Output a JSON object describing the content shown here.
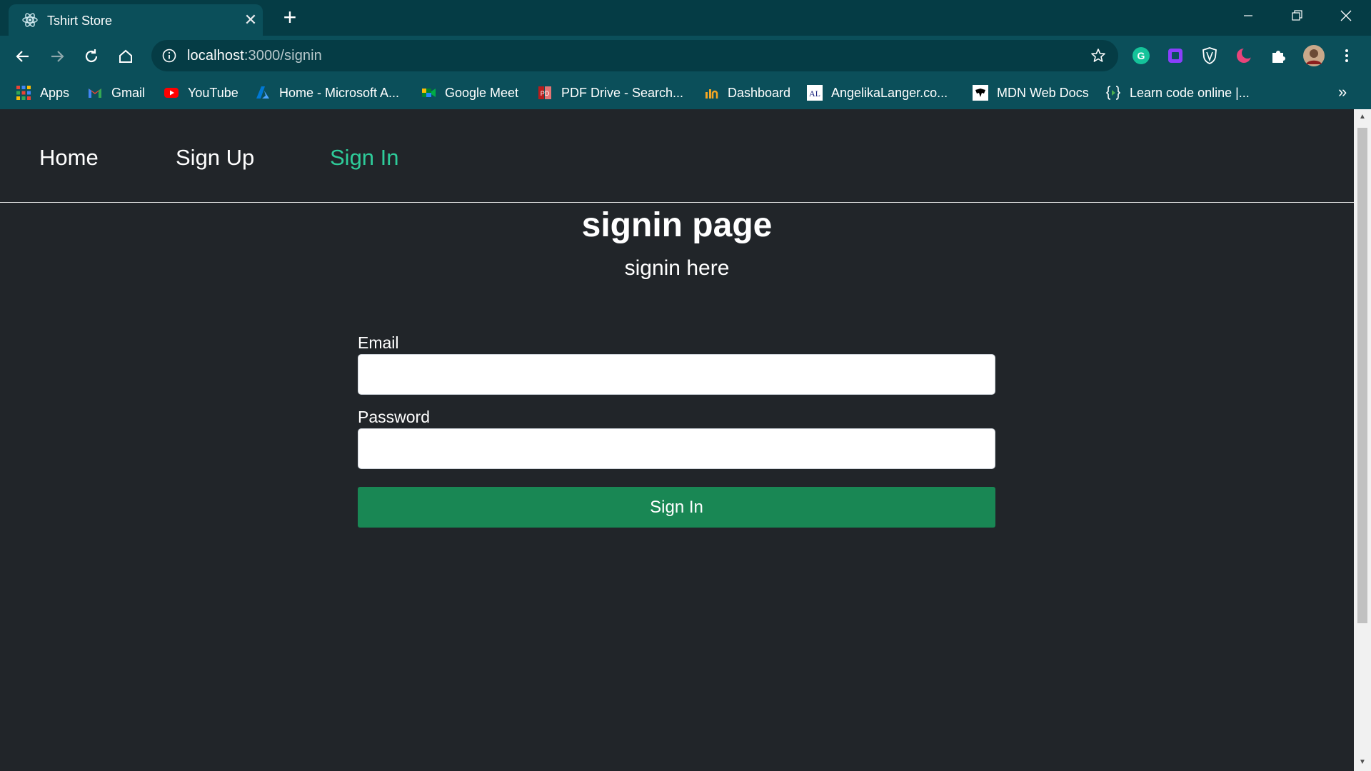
{
  "browser": {
    "tab": {
      "title": "Tshirt Store",
      "favicon": "react-atom-icon"
    },
    "url_host": "localhost",
    "url_path": ":3000/signin",
    "bookmarks": [
      {
        "label": "Apps",
        "icon": "apps-grid-icon"
      },
      {
        "label": "Gmail",
        "icon": "gmail-icon"
      },
      {
        "label": "YouTube",
        "icon": "youtube-icon"
      },
      {
        "label": "Home - Microsoft A...",
        "icon": "azure-icon"
      },
      {
        "label": "Google Meet",
        "icon": "google-meet-icon"
      },
      {
        "label": "PDF Drive - Search...",
        "icon": "pdf-drive-icon"
      },
      {
        "label": "Dashboard",
        "icon": "dashboard-icon"
      },
      {
        "label": "AngelikaLanger.co...",
        "icon": "angelika-langer-icon"
      },
      {
        "label": "MDN Web Docs",
        "icon": "mdn-icon"
      },
      {
        "label": "Learn code online |...",
        "icon": "code-brackets-icon"
      }
    ],
    "more_bookmarks": "»"
  },
  "site": {
    "nav": {
      "home": "Home",
      "signup": "Sign Up",
      "signin": "Sign In"
    },
    "title": "signin page",
    "subtitle": "signin here",
    "form": {
      "email_label": "Email",
      "email_value": "",
      "password_label": "Password",
      "password_value": "",
      "submit_label": "Sign In"
    }
  },
  "colors": {
    "chrome_bg": "#0b4f5a",
    "page_bg": "#212529",
    "active_link": "#2ecc9a",
    "submit_bg": "#198754"
  }
}
